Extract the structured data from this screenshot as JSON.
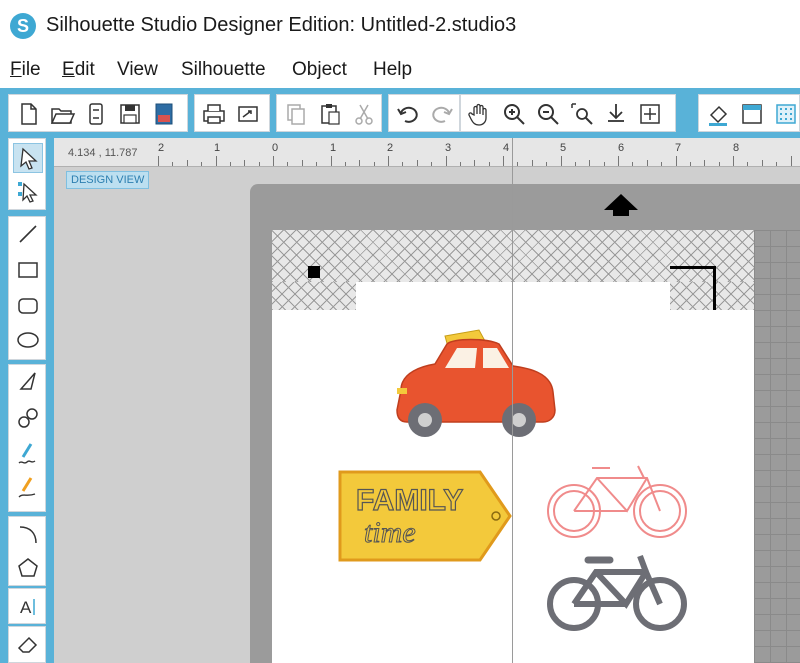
{
  "window": {
    "title": "Silhouette Studio Designer Edition: Untitled-2.studio3",
    "logo_letter": "S"
  },
  "menu": [
    {
      "first": "F",
      "rest": "ile"
    },
    {
      "first": "E",
      "rest": "dit"
    },
    {
      "first": "",
      "rest": "View"
    },
    {
      "first": "",
      "rest": "Silhouette"
    },
    {
      "first": "",
      "rest": "Object"
    },
    {
      "first": "",
      "rest": "Help"
    }
  ],
  "toolbar": {
    "icons": [
      "new-document-icon",
      "open-folder-icon",
      "open-cloud-icon",
      "save-icon",
      "save-to-sd-icon",
      "print-icon",
      "send-to-silhouette-icon",
      "copy-icon",
      "paste-icon",
      "cut-icon",
      "undo-icon",
      "redo-icon",
      "pan-hand-icon",
      "zoom-in-icon",
      "zoom-out-icon",
      "zoom-select-icon",
      "zoom-drag-icon",
      "fit-to-page-icon",
      "fill-bucket-icon",
      "line-color-icon",
      "pattern-icon"
    ]
  },
  "left_tools": {
    "icons": [
      "select-arrow-icon",
      "point-edit-icon",
      "line-tool-icon",
      "rectangle-tool-icon",
      "rounded-rectangle-tool-icon",
      "ellipse-tool-icon",
      "polygon-tool-icon",
      "curve-tool-icon",
      "freehand-tool-icon",
      "smooth-freehand-tool-icon",
      "arc-tool-icon",
      "regular-polygon-tool-icon",
      "text-tool-icon",
      "eraser-tool-icon"
    ]
  },
  "ruler": {
    "coordinates": "4.134 , 11.787",
    "labels": [
      "2",
      "1",
      "0",
      "1",
      "2",
      "3",
      "4",
      "5",
      "6",
      "7",
      "8"
    ]
  },
  "design_view_label": "DESIGN VIEW",
  "artwork": {
    "tag_text_top": "FAMILY",
    "tag_text_script": "time",
    "colors": {
      "accent": "#59b2d8",
      "car": "#e8542f",
      "tag": "#f3c93b",
      "bike_outline": "#f08b8b",
      "bike_solid": "#6d6e75"
    }
  }
}
